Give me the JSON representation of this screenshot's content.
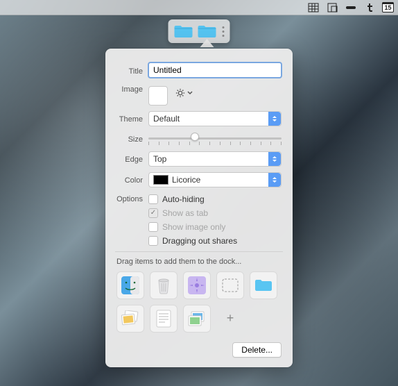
{
  "menubar": {
    "items": [
      "grid-icon",
      "fullscreen-icon",
      "gap-icon",
      "tumblr-icon",
      "calendar-icon"
    ],
    "date": "15"
  },
  "dock": {
    "tabs": [
      {
        "kind": "folder",
        "active": false
      },
      {
        "kind": "folder",
        "active": true
      }
    ]
  },
  "form": {
    "labels": {
      "title": "Title",
      "image": "Image",
      "theme": "Theme",
      "size": "Size",
      "edge": "Edge",
      "color": "Color",
      "options": "Options"
    },
    "title_value": "Untitled",
    "theme_value": "Default",
    "edge_value": "Top",
    "color_value": "Licorice",
    "color_swatch": "#000000",
    "size_percent": 35,
    "size_ticks": 14,
    "options": [
      {
        "label": "Auto-hiding",
        "checked": false,
        "disabled": false
      },
      {
        "label": "Show as tab",
        "checked": true,
        "disabled": true
      },
      {
        "label": "Show image only",
        "checked": false,
        "disabled": true
      },
      {
        "label": "Dragging out shares",
        "checked": false,
        "disabled": false
      }
    ],
    "hint": "Drag items to add them to the dock...",
    "tiles": [
      {
        "name": "finder-icon"
      },
      {
        "name": "trash-icon"
      },
      {
        "name": "burst-icon"
      },
      {
        "name": "dashed-rect-icon"
      },
      {
        "name": "folder-plain-icon"
      },
      {
        "name": "photos-icon"
      },
      {
        "name": "textedit-icon"
      },
      {
        "name": "preview-icon"
      },
      {
        "name": "add-slot",
        "add": true
      }
    ],
    "delete_label": "Delete..."
  }
}
